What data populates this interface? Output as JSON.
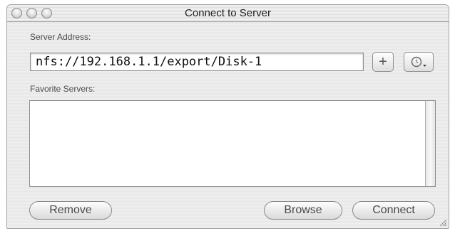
{
  "window": {
    "title": "Connect to Server"
  },
  "server_address": {
    "label": "Server Address:",
    "value": "nfs://192.168.1.1/export/Disk-1"
  },
  "buttons": {
    "add_favorite": "+",
    "remove": "Remove",
    "browse": "Browse",
    "connect": "Connect"
  },
  "favorites": {
    "label": "Favorite Servers:",
    "items": []
  },
  "icons": {
    "traffic_lights": [
      "close-icon",
      "minimize-icon",
      "zoom-icon"
    ],
    "recent": "clock-icon",
    "resize": "resize-grip-icon"
  }
}
